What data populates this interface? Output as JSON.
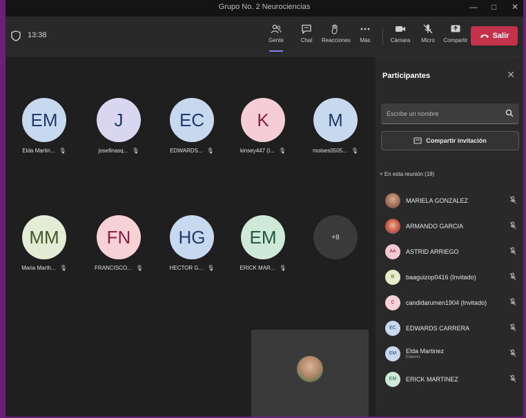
{
  "window": {
    "title": "Grupo No. 2 Neurociencias"
  },
  "toolbar": {
    "time": "13:38",
    "buttons": [
      {
        "label": "Gente",
        "icon": "people-icon"
      },
      {
        "label": "Chat",
        "icon": "chat-icon"
      },
      {
        "label": "Reacciones",
        "icon": "reactions-icon"
      },
      {
        "label": "Más",
        "icon": "more-icon"
      },
      {
        "label": "Cámara",
        "icon": "camera-icon"
      },
      {
        "label": "Micro",
        "icon": "mic-off-icon"
      },
      {
        "label": "Compartir",
        "icon": "share-icon"
      }
    ],
    "leave_label": "Salir",
    "leave_color": "#c4314b"
  },
  "stage": {
    "tiles": [
      {
        "initials": "EM",
        "name": "Elda Martin...",
        "color": "#c7d9ee"
      },
      {
        "initials": "J",
        "name": "josefinasq...",
        "color": "#d9d6ef"
      },
      {
        "initials": "EC",
        "name": "EDWARDS...",
        "color": "#c7d9ee"
      },
      {
        "initials": "K",
        "name": "kinsey447 (I...",
        "color": "#f4cdd6"
      },
      {
        "initials": "M",
        "name": "moises0505...",
        "color": "#c7d9ee"
      },
      {
        "initials": "MM",
        "name": "Maria Marth...",
        "color": "#e4ecd5"
      },
      {
        "initials": "FN",
        "name": "FRANCISCO...",
        "color": "#f6d2d6"
      },
      {
        "initials": "HG",
        "name": "HECTOR G...",
        "color": "#c7d9ee"
      },
      {
        "initials": "EM",
        "name": "ERICK MAR...",
        "color": "#cfe9d9"
      }
    ],
    "more_label": "+8"
  },
  "panel": {
    "title": "Participantes",
    "search_placeholder": "Escribe un nombre",
    "share_label": "Compartir invitación",
    "section_label": "En esta reunión (18)",
    "participants": [
      {
        "initials": "",
        "name": "MARIELA GONZALEZ",
        "sub": "",
        "color": "#a0725a",
        "photo": true
      },
      {
        "initials": "",
        "name": "ARMANDO GARCIA",
        "sub": "",
        "color": "#c9563f",
        "photo": true
      },
      {
        "initials": "AA",
        "name": "ASTRID ARRIEGO",
        "sub": "",
        "color": "#f2c9d0",
        "photo": false
      },
      {
        "initials": "B",
        "name": "baaguizop0416 (Invitado)",
        "sub": "",
        "color": "#e6ecc9",
        "photo": false
      },
      {
        "initials": "C",
        "name": "candidarumen1904 (Invitado)",
        "sub": "",
        "color": "#f6d2d6",
        "photo": false
      },
      {
        "initials": "EC",
        "name": "EDWARDS CARRERA",
        "sub": "",
        "color": "#c7d9ee",
        "photo": false
      },
      {
        "initials": "EM",
        "name": "Elda Martinez",
        "sub": "Externo",
        "color": "#c7d9ee",
        "photo": false
      },
      {
        "initials": "EM",
        "name": "ERICK MARTINEZ",
        "sub": "",
        "color": "#cfe9d9",
        "photo": false
      }
    ]
  }
}
